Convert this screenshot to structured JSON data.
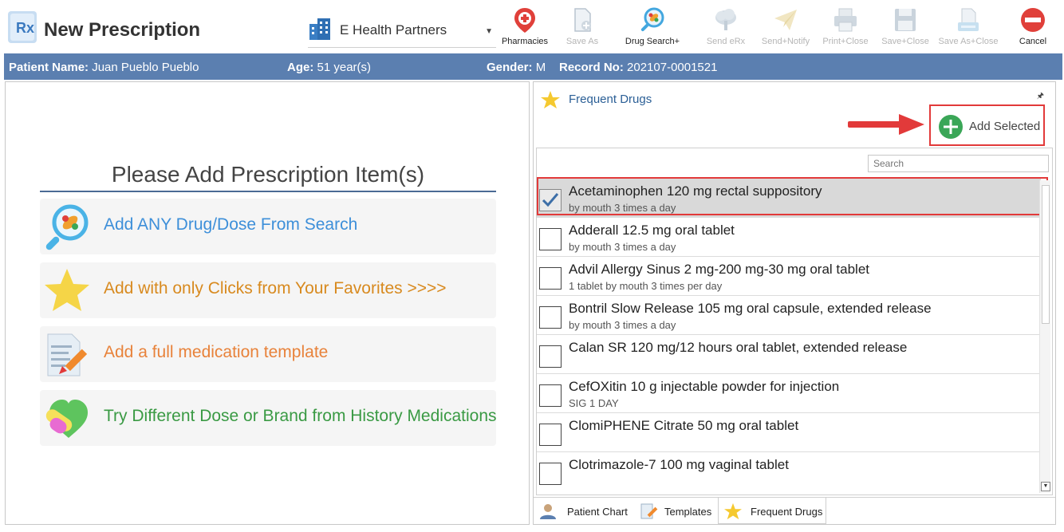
{
  "header": {
    "title": "New Prescription",
    "practice": "E Health Partners",
    "toolbar": [
      {
        "label": "Pharmacies",
        "icon": "pharmacy-pin-icon",
        "enabled": true
      },
      {
        "label": "Save As",
        "icon": "save-as-icon",
        "enabled": false
      },
      {
        "label": "Drug Search+",
        "icon": "drug-search-icon",
        "enabled": true
      },
      {
        "label": "Send eRx",
        "icon": "cloud-send-icon",
        "enabled": false
      },
      {
        "label": "Send+Notify",
        "icon": "paper-plane-icon",
        "enabled": false
      },
      {
        "label": "Print+Close",
        "icon": "printer-icon",
        "enabled": false
      },
      {
        "label": "Save+Close",
        "icon": "floppy-icon",
        "enabled": false
      },
      {
        "label": "Save As+Close",
        "icon": "save-as-close-icon",
        "enabled": false
      },
      {
        "label": "Cancel",
        "icon": "cancel-icon",
        "enabled": true
      }
    ]
  },
  "patient": {
    "name_label": "Patient Name:",
    "name": "Juan Pueblo Pueblo",
    "age_label": "Age:",
    "age": "51 year(s)",
    "gender_label": "Gender:",
    "gender": "M",
    "record_label": "Record No:",
    "record": "202107-0001521"
  },
  "left": {
    "title": "Please Add Prescription Item(s)",
    "actions": [
      {
        "label": "Add ANY Drug/Dose From Search",
        "color": "#3d8fd9",
        "icon": "magnifier-pill-icon"
      },
      {
        "label": "Add with only Clicks from Your Favorites >>>>",
        "color": "#d88a1f",
        "icon": "star-icon"
      },
      {
        "label": "Add a full medication template",
        "color": "#e8823a",
        "icon": "document-pencil-icon"
      },
      {
        "label": "Try Different Dose or Brand from History Medications",
        "color": "#3a9a44",
        "icon": "pill-heart-icon"
      }
    ]
  },
  "right": {
    "title": "Frequent Drugs",
    "add_selected": "Add Selected",
    "search_placeholder": "Search",
    "drugs": [
      {
        "name": "Acetaminophen 120 mg rectal suppository",
        "sig": "by mouth 3 times a day",
        "checked": true
      },
      {
        "name": "Adderall 12.5 mg oral tablet",
        "sig": "by mouth 3 times a day",
        "checked": false
      },
      {
        "name": "Advil Allergy Sinus 2 mg-200 mg-30 mg oral tablet",
        "sig": "1 tablet by mouth 3 times per day",
        "checked": false
      },
      {
        "name": "Bontril Slow Release 105 mg oral capsule, extended release",
        "sig": "by mouth 3 times a day",
        "checked": false
      },
      {
        "name": "Calan SR 120 mg/12 hours oral tablet, extended release",
        "sig": "",
        "checked": false
      },
      {
        "name": "CefOXitin 10 g injectable powder for injection",
        "sig": "SIG 1 DAY",
        "checked": false
      },
      {
        "name": "ClomiPHENE Citrate 50 mg oral tablet",
        "sig": "",
        "checked": false
      },
      {
        "name": "Clotrimazole-7 100 mg vaginal tablet",
        "sig": "",
        "checked": false
      }
    ],
    "tabs": [
      {
        "label": "Patient Chart",
        "icon": "patient-chart-icon"
      },
      {
        "label": "Templates",
        "icon": "templates-icon"
      },
      {
        "label": "Frequent Drugs",
        "icon": "star-icon",
        "active": true
      }
    ]
  },
  "colors": {
    "accent_bar": "#5b7fb0",
    "highlight": "#e23a3a",
    "add_green": "#3aa657"
  }
}
